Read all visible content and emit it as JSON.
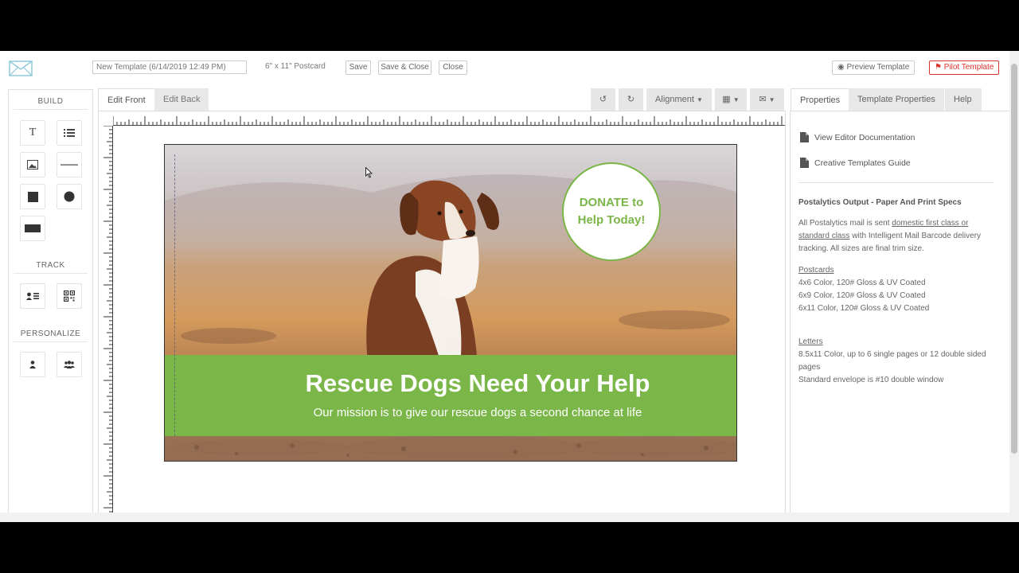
{
  "toolbar": {
    "template_name": "New Template (6/14/2019 12:49 PM)",
    "size_label": "6\" x 11\" Postcard",
    "save_label": "Save",
    "save_close_label": "Save & Close",
    "close_label": "Close",
    "preview_label": "Preview Template",
    "pilot_label": "Pilot Template"
  },
  "left_panel": {
    "build_heading": "BUILD",
    "track_heading": "TRACK",
    "personalize_heading": "PERSONALIZE",
    "build_tools": [
      "text-tool",
      "list-tool",
      "image-tool",
      "line-tool",
      "square-tool",
      "circle-tool",
      "rectangle-tool"
    ],
    "track_tools": [
      "contact-tool",
      "qr-code-tool"
    ],
    "personalize_tools": [
      "person-tool",
      "group-tool"
    ]
  },
  "editor": {
    "tab_front": "Edit Front",
    "tab_back": "Edit Back",
    "alignment_label": "Alignment"
  },
  "postcard": {
    "donate_text": "DONATE to Help Today!",
    "headline": "Rescue Dogs Need Your Help",
    "subline": "Our mission is to give our rescue dogs a second chance at life"
  },
  "right_panel": {
    "tab_properties": "Properties",
    "tab_template_properties": "Template Properties",
    "tab_help": "Help",
    "doc_link_1": "View Editor Documentation",
    "doc_link_2": "Creative Templates Guide",
    "specs_heading": "Postalytics Output - Paper And Print Specs",
    "specs_intro_1": "All Postalytics mail is sent ",
    "specs_intro_link": "domestic first class or standard class",
    "specs_intro_2": " with Intelligent Mail Barcode delivery tracking. All sizes are final trim size.",
    "postcards_heading": "Postcards",
    "postcards": [
      "4x6 Color, 120# Gloss & UV Coated",
      "6x9 Color, 120# Gloss & UV Coated",
      "6x11 Color, 120# Gloss & UV Coated"
    ],
    "letters_heading": "Letters",
    "letters": [
      "8.5x11 Color, up to 6 single pages or 12 double sided pages",
      "Standard envelope is #10 double window"
    ]
  },
  "colors": {
    "accent_green": "#7ab648",
    "pilot_red": "#d9342b"
  }
}
